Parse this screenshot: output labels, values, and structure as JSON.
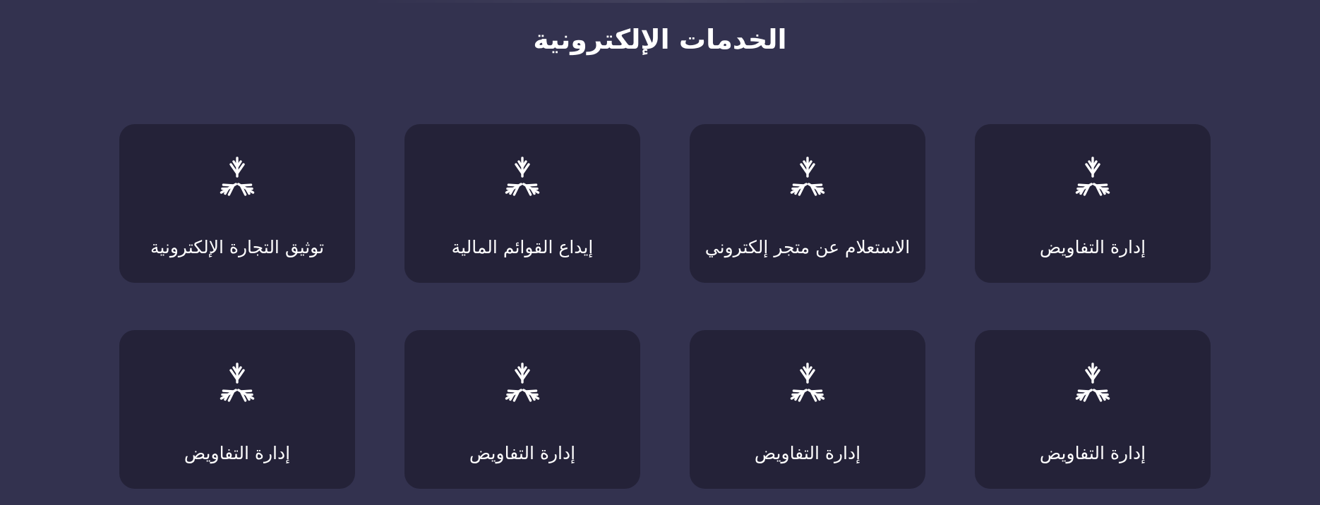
{
  "page": {
    "title": "الخدمات الإلكترونية"
  },
  "colors": {
    "background": "#33324f",
    "card": "#242238",
    "text": "#ffffff"
  },
  "services": [
    {
      "label": "إدارة التفاويض",
      "icon": "tri-leaf-logo-icon"
    },
    {
      "label": "الاستعلام عن متجر إلكتروني",
      "icon": "tri-leaf-logo-icon"
    },
    {
      "label": "إيداع القوائم المالية",
      "icon": "tri-leaf-logo-icon"
    },
    {
      "label": "توثيق التجارة الإلكترونية",
      "icon": "tri-leaf-logo-icon"
    },
    {
      "label": "إدارة التفاويض",
      "icon": "tri-leaf-logo-icon"
    },
    {
      "label": "إدارة التفاويض",
      "icon": "tri-leaf-logo-icon"
    },
    {
      "label": "إدارة التفاويض",
      "icon": "tri-leaf-logo-icon"
    },
    {
      "label": "إدارة التفاويض",
      "icon": "tri-leaf-logo-icon"
    }
  ]
}
